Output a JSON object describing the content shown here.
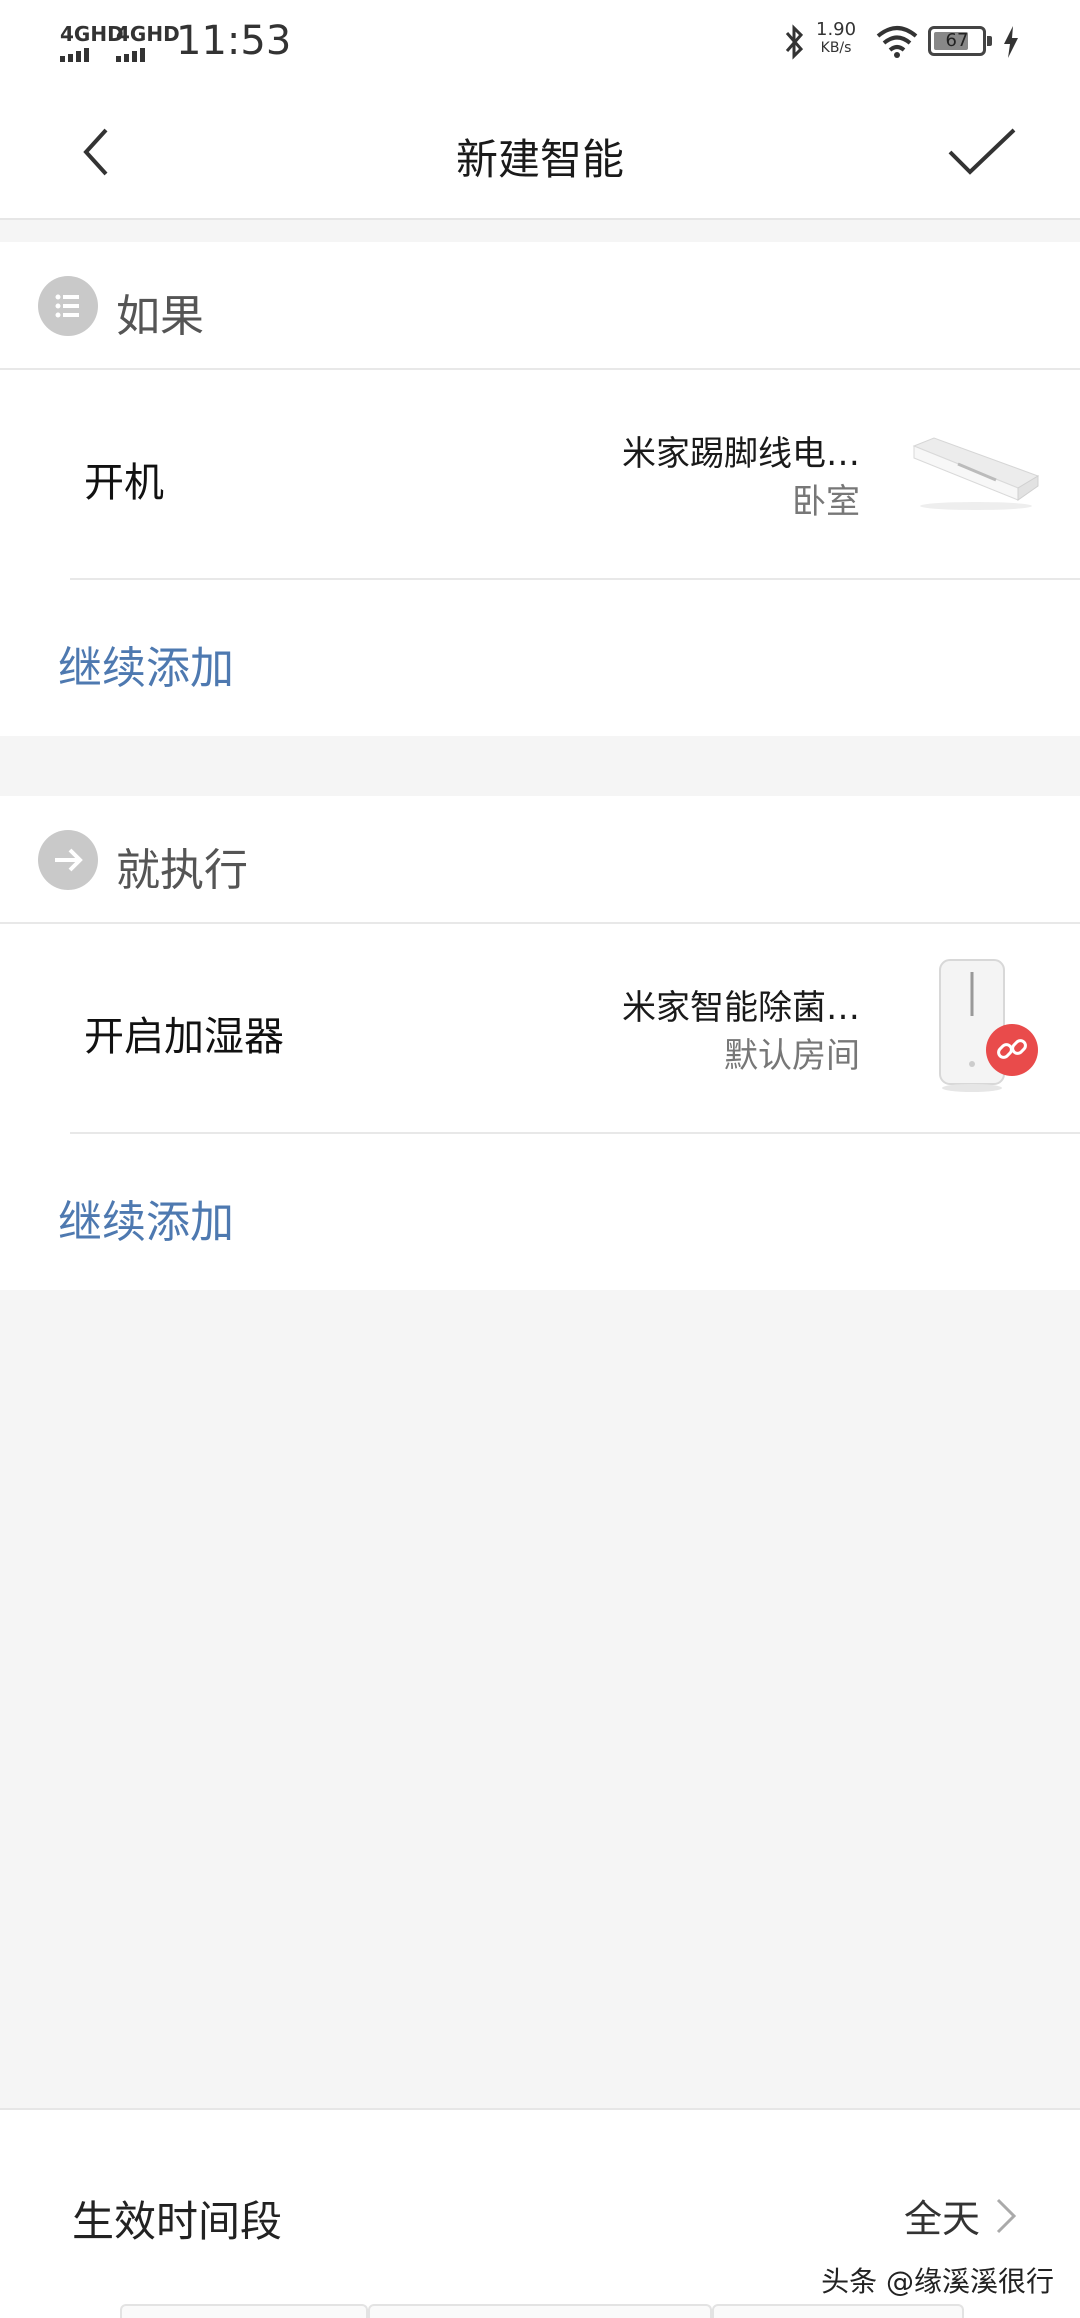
{
  "status_bar": {
    "net1": "4GHD",
    "net2": "4GHD",
    "time": "11:53",
    "speed_value": "1.90",
    "speed_unit": "KB/s",
    "battery": "67"
  },
  "header": {
    "title": "新建智能",
    "back_icon": "chevron-left-icon",
    "confirm_icon": "check-icon"
  },
  "if_section": {
    "title": "如果",
    "icon": "list-icon",
    "row": {
      "title": "开机",
      "device_name": "米家踢脚线电…",
      "room": "卧室",
      "image": "baseboard-heater"
    },
    "add_label": "继续添加"
  },
  "then_section": {
    "title": "就执行",
    "icon": "arrow-right-icon",
    "row": {
      "title": "开启加湿器",
      "device_name": "米家智能除菌…",
      "room": "默认房间",
      "image": "humidifier",
      "badge_icon": "link-broken-icon"
    },
    "add_label": "继续添加"
  },
  "effective_period": {
    "label": "生效时间段",
    "value": "全天"
  },
  "watermark": "头条 @缘溪溪很行",
  "colors": {
    "link": "#4e79b0",
    "section_icon": "#c9c9c9",
    "badge": "#e94b4b",
    "background": "#f5f5f5"
  }
}
